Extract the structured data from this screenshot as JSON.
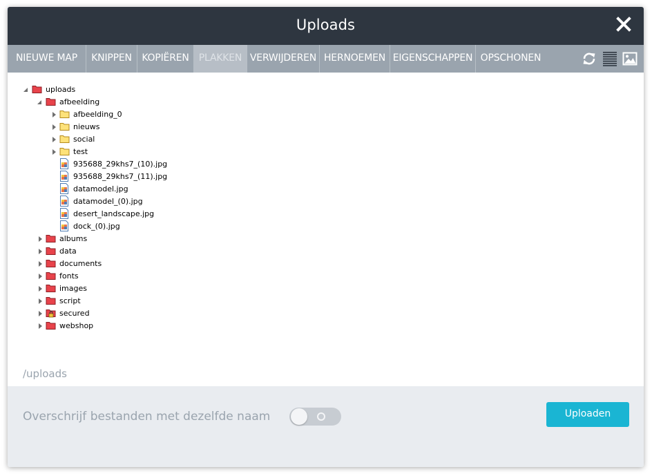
{
  "dialog": {
    "title": "Uploads"
  },
  "toolbar": {
    "buttons": [
      {
        "label": "NIEUWE MAP"
      },
      {
        "label": "KNIPPEN"
      },
      {
        "label": "KOPIËREN"
      },
      {
        "label": "PLAKKEN",
        "disabled": true
      },
      {
        "label": "VERWIJDEREN"
      },
      {
        "label": "HERNOEMEN"
      },
      {
        "label": "EIGENSCHAPPEN"
      },
      {
        "label": "OPSCHONEN"
      }
    ],
    "icons": [
      "refresh-icon",
      "list-view-icon",
      "thumbnail-view-icon"
    ]
  },
  "tree": {
    "root": "uploads",
    "afbeelding": "afbeelding",
    "afbeelding_children": {
      "folders": [
        "afbeelding_0",
        "nieuws",
        "social",
        "test"
      ],
      "files": [
        "935688_29khs7_(10).jpg",
        "935688_29khs7_(11).jpg",
        "datamodel.jpg",
        "datamodel_(0).jpg",
        "desert_landscape.jpg",
        "dock_(0).jpg"
      ]
    },
    "other_folders": [
      "albums",
      "data",
      "documents",
      "fonts",
      "images",
      "script",
      "secured",
      "webshop"
    ]
  },
  "current_path": "/uploads",
  "footer": {
    "overwrite_label": "Overschrijf bestanden met dezelfde naam",
    "overwrite_enabled": false,
    "upload_label": "Uploaden"
  },
  "colors": {
    "titlebar": "#2e3640",
    "toolbar": "#9aa4ae",
    "accent": "#1ab5d3",
    "red_folder": "#e8434b",
    "yellow_folder": "#fde27a"
  }
}
